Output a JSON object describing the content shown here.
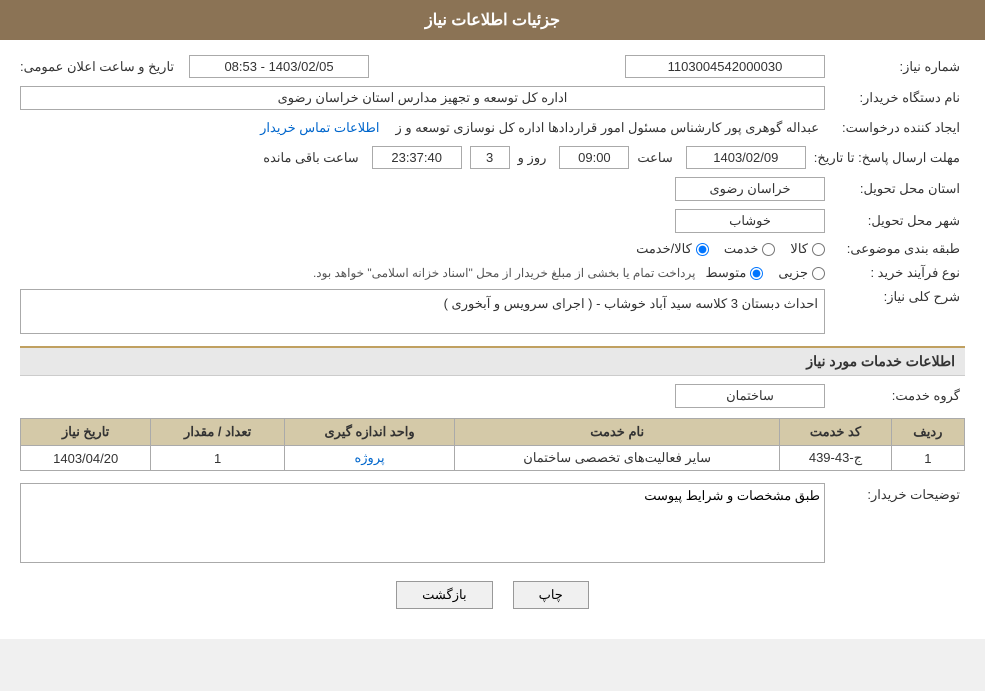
{
  "header": {
    "title": "جزئیات اطلاعات نیاز"
  },
  "fields": {
    "need_number_label": "شماره نیاز:",
    "need_number_value": "1103004542000030",
    "announce_date_label": "تاریخ و ساعت اعلان عمومی:",
    "announce_date_value": "1403/02/05 - 08:53",
    "buyer_org_label": "نام دستگاه خریدار:",
    "buyer_org_value": "اداره کل توسعه  و تجهیز مدارس استان خراسان رضوی",
    "creator_label": "ایجاد کننده درخواست:",
    "creator_value": "عبداله گوهری پور کارشناس مسئول امور قراردادها  اداره کل نوسازی  توسعه و ز",
    "creator_link": "اطلاعات تماس خریدار",
    "deadline_label": "مهلت ارسال پاسخ: تا تاریخ:",
    "deadline_date": "1403/02/09",
    "deadline_time_label": "ساعت",
    "deadline_time": "09:00",
    "deadline_day_label": "روز و",
    "deadline_days": "3",
    "deadline_remaining_label": "ساعت باقی مانده",
    "deadline_remaining": "23:37:40",
    "province_label": "استان محل تحویل:",
    "province_value": "خراسان رضوی",
    "city_label": "شهر محل تحویل:",
    "city_value": "خوشاب",
    "category_label": "طبقه بندی موضوعی:",
    "category_kala": "کالا",
    "category_khedmat": "خدمت",
    "category_kala_khedmat": "کالا/خدمت",
    "category_selected": "kala_khedmat",
    "purchase_type_label": "نوع فرآیند خرید :",
    "purchase_jozvi": "جزیی",
    "purchase_motavaset": "متوسط",
    "purchase_desc": "پرداخت تمام یا بخشی از مبلغ خریدار از محل \"اسناد خزانه اسلامی\" خواهد بود.",
    "general_description_label": "شرح کلی نیاز:",
    "general_description_value": "احداث دبستان 3 کلاسه سید آباد خوشاب - ( اجرای سرویس و آبخوری )",
    "services_section_title": "اطلاعات خدمات مورد نیاز",
    "service_group_label": "گروه خدمت:",
    "service_group_value": "ساختمان",
    "table_headers": {
      "row_num": "ردیف",
      "service_code": "کد خدمت",
      "service_name": "نام خدمت",
      "unit": "واحد اندازه گیری",
      "quantity": "تعداد / مقدار",
      "date": "تاریخ نیاز"
    },
    "table_rows": [
      {
        "row_num": "1",
        "service_code": "ج-43-439",
        "service_name": "سایر فعالیت‌های تخصصی ساختمان",
        "unit": "پروژه",
        "quantity": "1",
        "date": "1403/04/20"
      }
    ],
    "buyer_notes_label": "توضیحات خریدار:",
    "buyer_notes_value": "طبق مشخصات و شرایط پیوست"
  },
  "buttons": {
    "print_label": "چاپ",
    "back_label": "بازگشت"
  }
}
